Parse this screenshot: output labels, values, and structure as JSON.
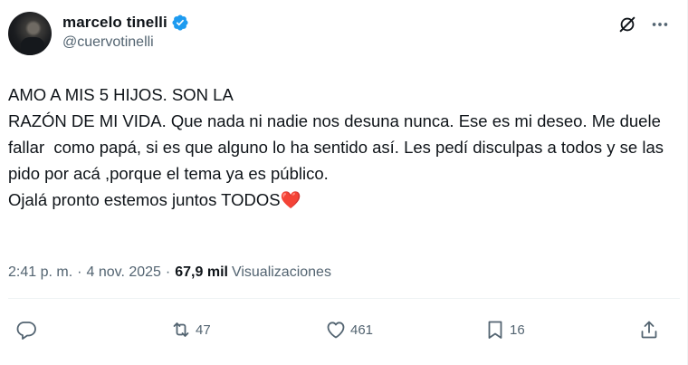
{
  "user": {
    "display_name": "marcelo tinelli",
    "handle": "@cuervotinelli",
    "verified": true
  },
  "tweet": {
    "text": "AMO A MIS 5 HIJOS. SON LA\nRAZÓN DE MI VIDA. Que nada ni nadie nos desuna nunca. Ese es mi deseo. Me duele fallar  como papá, si es que alguno lo ha sentido así. Les pedí disculpas a todos y se las pido por acá ,porque el tema ya es público.\nOjalá pronto estemos juntos TODOS",
    "emoji": "❤️",
    "time": "2:41 p. m.",
    "separator": "·",
    "date": "4 nov. 2025",
    "views_count": "67,9 mil",
    "views_label": "Visualizaciones"
  },
  "actions": {
    "reply_count": "",
    "repost_count": "47",
    "like_count": "461",
    "bookmark_count": "16"
  },
  "icons": {
    "verified": "verified-badge-icon",
    "grok": "grok-icon",
    "more": "more-options-icon",
    "reply": "reply-icon",
    "repost": "repost-icon",
    "like": "heart-icon",
    "bookmark": "bookmark-icon",
    "share": "share-icon"
  },
  "colors": {
    "verified_blue": "#1d9bf0",
    "secondary_text": "#536471",
    "primary_text": "#0f1419",
    "heart_red": "#e0245e"
  }
}
